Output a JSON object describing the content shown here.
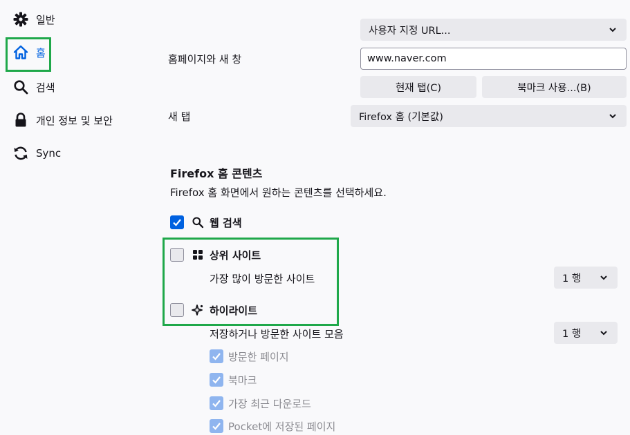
{
  "sidebar": {
    "items": [
      {
        "label": "일반",
        "icon": "gear-icon"
      },
      {
        "label": "홈",
        "icon": "home-icon",
        "active": true
      },
      {
        "label": "검색",
        "icon": "search-icon"
      },
      {
        "label": "개인 정보 및 보안",
        "icon": "lock-icon"
      },
      {
        "label": "Sync",
        "icon": "sync-icon"
      }
    ]
  },
  "homepage": {
    "label": "홈페이지와 새 창",
    "mode_selected": "사용자 지정 URL...",
    "url_value": "www.naver.com",
    "use_current_button": "현재 탭(C)",
    "use_bookmark_button": "북마크 사용...(B)"
  },
  "newtab": {
    "label": "새 탭",
    "selected": "Firefox 홈 (기본값)"
  },
  "content": {
    "title": "Firefox 홈 콘텐츠",
    "description": "Firefox 홈 화면에서 원하는 콘텐츠를 선택하세요.",
    "web_search": {
      "label": "웹 검색",
      "checked": true,
      "icon": "search-icon"
    },
    "top_sites": {
      "label": "상위 사이트",
      "checked": false,
      "icon": "grid-icon",
      "sublabel": "가장 많이 방문한 사이트",
      "rows_selected": "1 행"
    },
    "highlights": {
      "label": "하이라이트",
      "checked": false,
      "icon": "sparkle-icon",
      "sublabel": "저장하거나 방문한 사이트 모음",
      "rows_selected": "1 행",
      "suboptions": [
        {
          "label": "방문한 페이지",
          "checked": true,
          "disabled": true
        },
        {
          "label": "북마크",
          "checked": true,
          "disabled": true
        },
        {
          "label": "가장 최근 다운로드",
          "checked": true,
          "disabled": true
        },
        {
          "label": "Pocket에 저장된 페이지",
          "checked": true,
          "disabled": true
        }
      ]
    }
  },
  "colors": {
    "accent": "#0061e0",
    "highlight_box": "#1fa84a",
    "background": "#f9f9fb"
  }
}
